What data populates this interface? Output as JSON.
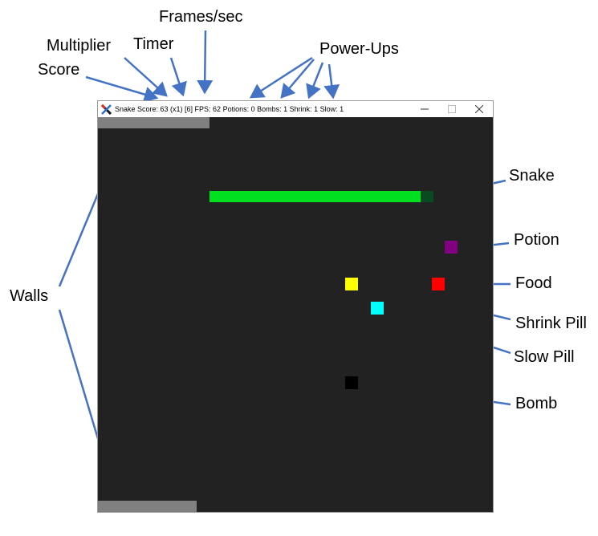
{
  "window": {
    "title": "Snake Score: 63 (x1) [6] FPS: 62 Potions: 0 Bombs: 1 Shrink: 1 Slow: 1",
    "app_icon": "x-logo-icon",
    "controls": [
      "minimize",
      "maximize",
      "close"
    ]
  },
  "annotations": {
    "frames_per_sec": "Frames/sec",
    "multiplier": "Multiplier",
    "timer": "Timer",
    "score": "Score",
    "power_ups": "Power-Ups",
    "snake": "Snake",
    "potion": "Potion",
    "food": "Food",
    "walls": "Walls",
    "shrink_pill": "Shrink Pill",
    "slow_pill": "Slow Pill",
    "bomb": "Bomb"
  },
  "colors": {
    "background": "#222222",
    "wall": "#808080",
    "snake_body": "#00e020",
    "snake_head": "#0a4a20",
    "potion": "#800080",
    "food": "#ff0000",
    "shrink_pill": "#ffff00",
    "slow_pill": "#00ffff",
    "bomb": "#000000",
    "arrow": "#4472c4"
  }
}
